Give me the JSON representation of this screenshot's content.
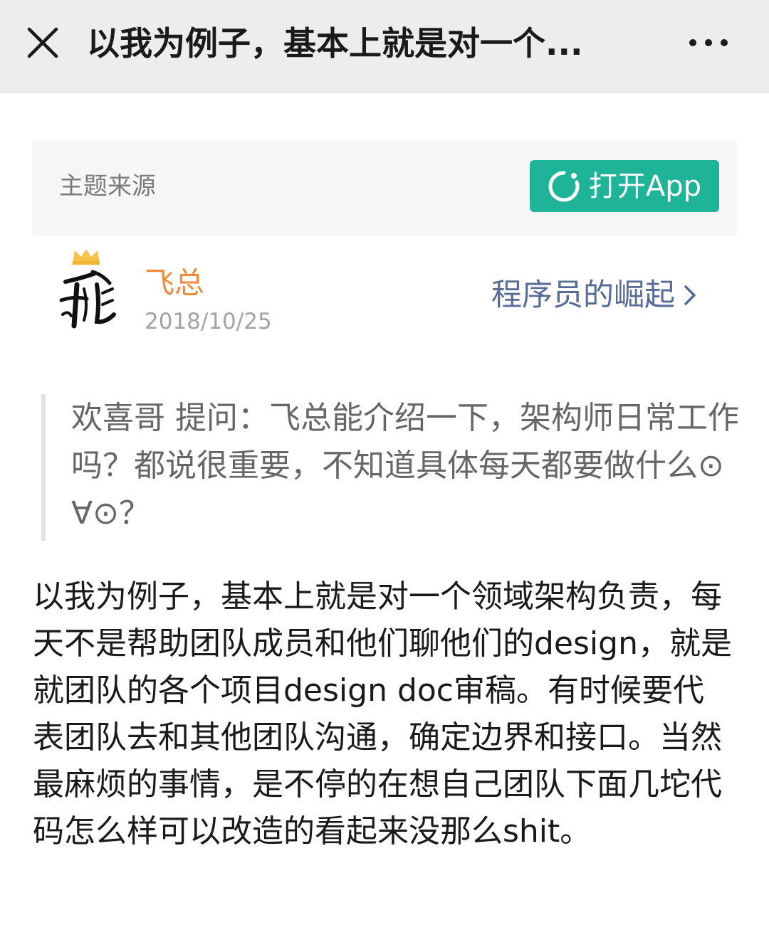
{
  "header": {
    "title": "以我为例子，基本上就是对一个...",
    "close_icon": "close-icon",
    "more_icon": "more-icon"
  },
  "source_banner": {
    "label": "主题来源",
    "open_app_label": "打开App",
    "button_color": "#1fb497"
  },
  "author": {
    "name": "飞总",
    "date": "2018/10/25",
    "name_color": "#f08a3b",
    "avatar_icon": "crown-icon"
  },
  "community": {
    "name": "程序员的崛起",
    "color": "#576b95"
  },
  "question": {
    "text": "欢喜哥 提问：飞总能介绍一下，架构师日常工作吗？都说很重要，不知道具体每天都要做什么⊙∀⊙？"
  },
  "answer": {
    "text": "以我为例子，基本上就是对一个领域架构负责，每天不是帮助团队成员和他们聊他们的design，就是就团队的各个项目design doc审稿。有时候要代表团队去和其他团队沟通，确定边界和接口。当然最麻烦的事情，是不停的在想自己团队下面几坨代码怎么样可以改造的看起来没那么shit。"
  }
}
